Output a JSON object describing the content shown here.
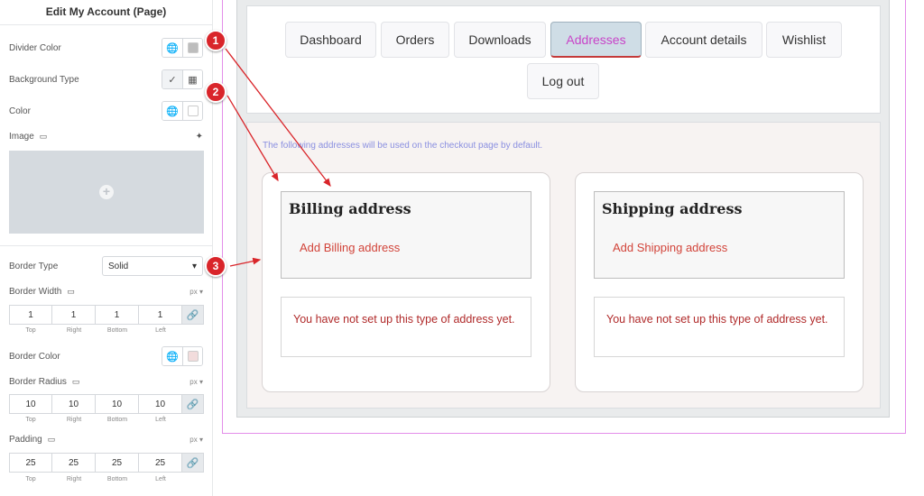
{
  "panel": {
    "title": "Edit My Account (Page)",
    "divider_color_label": "Divider Color",
    "background_type_label": "Background Type",
    "color_label": "Color",
    "image_label": "Image",
    "border_type_label": "Border Type",
    "border_type_value": "Solid",
    "border_width_label": "Border Width",
    "border_width_unit": "px",
    "border_width": [
      "1",
      "1",
      "1",
      "1"
    ],
    "border_color_label": "Border Color",
    "border_radius_label": "Border Radius",
    "border_radius_unit": "px",
    "border_radius": [
      "10",
      "10",
      "10",
      "10"
    ],
    "padding_label": "Padding",
    "padding_unit": "px",
    "padding": [
      "25",
      "25",
      "25",
      "25"
    ],
    "dim_labels": [
      "Top",
      "Right",
      "Bottom",
      "Left"
    ]
  },
  "nav": {
    "tabs": [
      "Dashboard",
      "Orders",
      "Downloads",
      "Addresses",
      "Account details",
      "Wishlist",
      "Log out"
    ],
    "active_tab": "Addresses"
  },
  "content": {
    "notice": "The following addresses will be used on the checkout page by default.",
    "billing": {
      "title": "Billing address",
      "link": "Add Billing address",
      "message": "You have not set up this type of address yet."
    },
    "shipping": {
      "title": "Shipping address",
      "link": "Add Shipping address",
      "message": "You have not set up this type of address yet."
    }
  },
  "markers": [
    "1",
    "2",
    "3"
  ],
  "colors": {
    "accent_active_tab": "#c844c8",
    "link_red": "#d2443a",
    "marker_red": "#d9252a",
    "frame_magenta": "#e38ee9"
  }
}
